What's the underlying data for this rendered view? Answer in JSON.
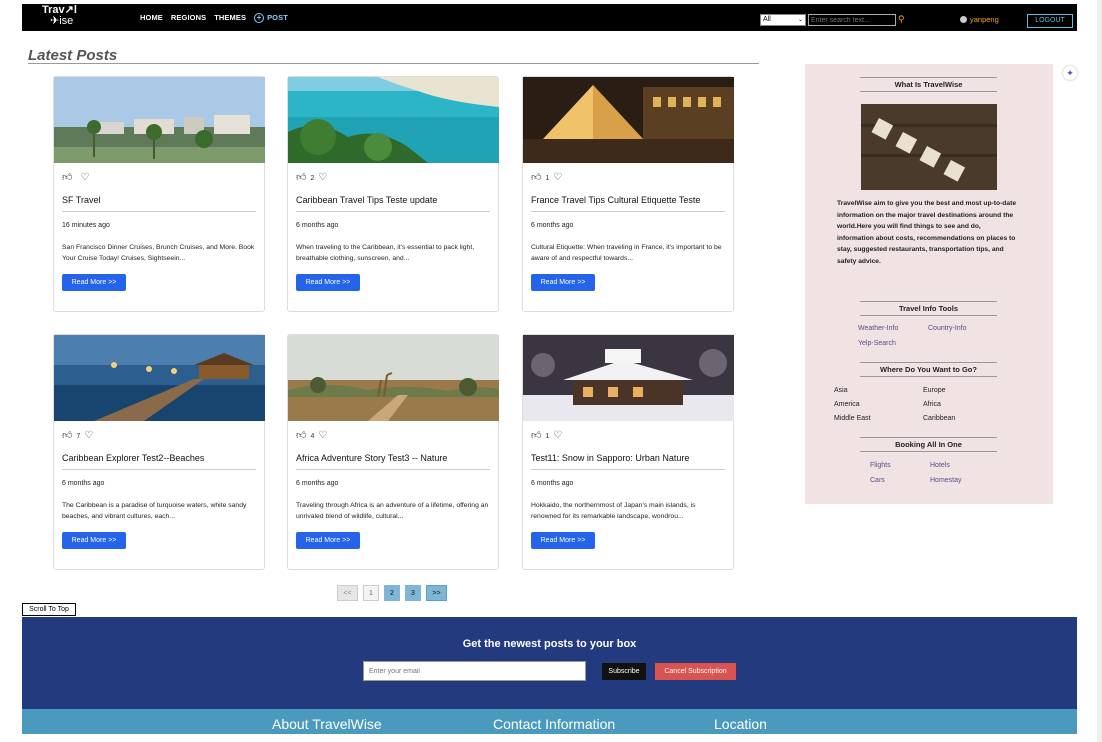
{
  "navbar": {
    "logo_line1": "Trav↗l",
    "logo_line2": "✈ise",
    "links": [
      "HOME",
      "REGIONS",
      "THEMES"
    ],
    "post_label": "POST",
    "search_select": "All",
    "search_placeholder": "Enter search text...",
    "username": "yanpeng",
    "logout_label": "LOGOUT"
  },
  "main": {
    "section_title": "Latest Posts",
    "read_more_label": "Read More >>",
    "posts": [
      {
        "likes": "",
        "title": "SF Travel",
        "time": "16 minutes ago",
        "excerpt": "San Francisco Dinner Cruises, Brunch Cruises, and More. Book Your Cruise Today! Cruises, Sightseein..."
      },
      {
        "likes": "2",
        "title": "Caribbean Travel Tips Teste update",
        "time": "6 months ago",
        "excerpt": "When traveling to the Caribbean, it's essential to pack light, breathable clothing, sunscreen, and..."
      },
      {
        "likes": "1",
        "title": "France Travel Tips Cultural Etiquette Teste",
        "time": "6 months ago",
        "excerpt": "Cultural Etiquette: When traveling in France, it's important to be aware of and respectful towards..."
      },
      {
        "likes": "7",
        "title": "Caribbean Explorer Test2--Beaches",
        "time": "6 months ago",
        "excerpt": "The Caribbean is a paradise of turquoise waters, white sandy beaches, and vibrant cultures, each..."
      },
      {
        "likes": "4",
        "title": "Africa Adventure Story Test3 -- Nature",
        "time": "6 months ago",
        "excerpt": "Traveling through Africa is an adventure of a lifetime, offering an unrivaled blend of wildlife, cultural..."
      },
      {
        "likes": "1",
        "title": "Test11: Snow in Sapporo: Urban Nature",
        "time": "6 months ago",
        "excerpt": "Hokkaido, the northernmost of Japan's main islands, is renowned for its remarkable landscape, wondrou..."
      }
    ],
    "pagination": [
      "<<",
      "1",
      "2",
      "3",
      ">>"
    ],
    "scroll_top_label": "Scroll To Top"
  },
  "sidebar": {
    "what_is_title": "What Is TravelWise",
    "blog_tiles": "BLOG",
    "description": "TravelWise aim to give you the best and most up-to-date information on the major travel destinations around the world.Here you will find things to see and do, information about costs, recommendations on places to stay, suggested restaurants, transportation tips, and safety advice.",
    "tools_title": "Travel Info Tools",
    "tools": [
      "Weather-Info",
      "Country-Info",
      "Yelp-Search"
    ],
    "regions_title": "Where Do You Want to Go?",
    "regions": [
      "Asia",
      "Europe",
      "America",
      "Africa",
      "Middle East",
      "Caribbean"
    ],
    "booking_title": "Booking All In One",
    "booking": [
      "Flights",
      "Hotels",
      "Cars",
      "Homestay"
    ]
  },
  "footer": {
    "newsletter_title": "Get the newest posts to your box",
    "email_placeholder": "Enter your email",
    "subscribe_label": "Subscribe",
    "cancel_label": "Cancel Subscription",
    "columns": [
      "About TravelWise",
      "Contact Information",
      "Location"
    ]
  },
  "colors": {
    "navbar_bg": "#000000",
    "accent_orange": "#f5a623",
    "read_more_blue": "#2563eb",
    "sidebar_bg": "#f1e3e3",
    "newsletter_bg": "#233a7e",
    "footer_bg": "#4a9abd",
    "cancel_red": "#d9534f"
  }
}
